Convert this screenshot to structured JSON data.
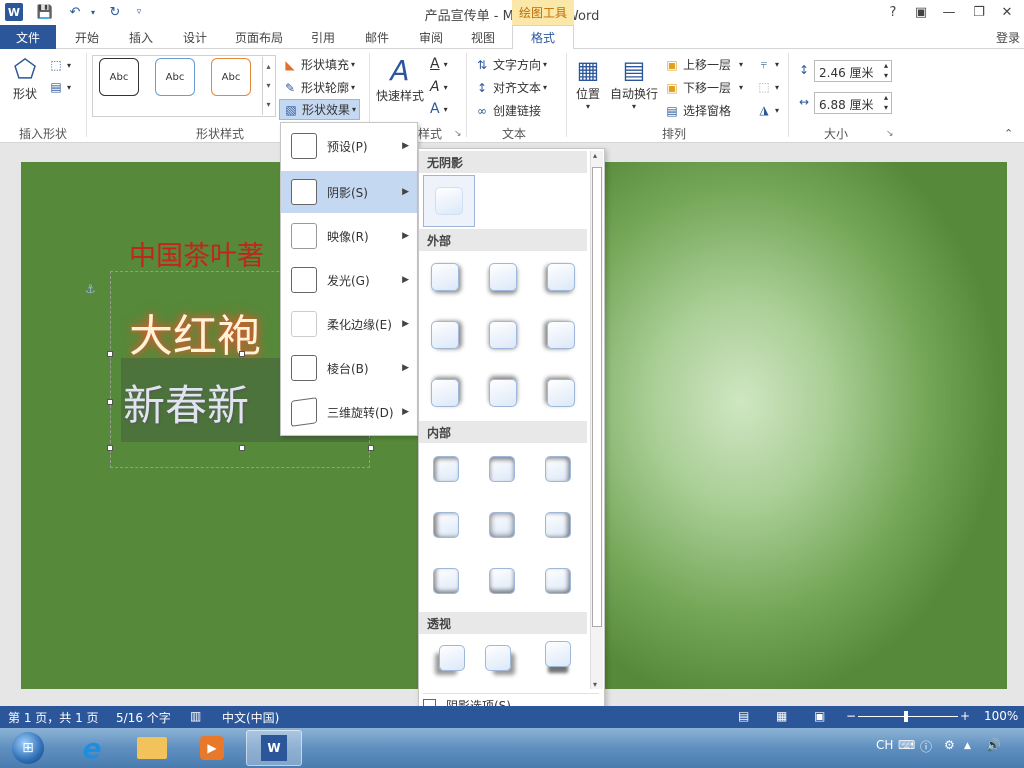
{
  "window": {
    "title": "产品宣传单 - Microsoft Word",
    "context_tab": "绘图工具",
    "logo": "W"
  },
  "tabs": {
    "file": "文件",
    "items": [
      "开始",
      "插入",
      "设计",
      "页面布局",
      "引用",
      "邮件",
      "审阅",
      "视图",
      "格式"
    ],
    "active": "格式",
    "login": "登录"
  },
  "ribbon": {
    "insert_shapes": {
      "shapes_label": "形状",
      "group": "插入形状"
    },
    "shape_styles": {
      "samples": [
        "Abc",
        "Abc",
        "Abc"
      ],
      "fill": "形状填充",
      "outline": "形状轮廓",
      "effects": "形状效果",
      "group": "形状样式"
    },
    "wordart": {
      "quick_styles": "快速样式",
      "group_partial": "样式"
    },
    "text": {
      "direction": "文字方向",
      "align": "对齐文本",
      "link": "创建链接",
      "group": "文本"
    },
    "arrange": {
      "position": "位置",
      "wrap": "自动换行",
      "bring_forward": "上移一层",
      "send_backward": "下移一层",
      "selection_pane": "选择窗格",
      "group": "排列"
    },
    "size": {
      "height": "2.46 厘米",
      "width": "6.88 厘米",
      "group": "大小"
    }
  },
  "document": {
    "line1": "中国茶叶著",
    "line2": "大红袍",
    "line3": "新春新"
  },
  "effects_menu": {
    "items": [
      {
        "label": "预设(P)"
      },
      {
        "label": "阴影(S)"
      },
      {
        "label": "映像(R)"
      },
      {
        "label": "发光(G)"
      },
      {
        "label": "柔化边缘(E)"
      },
      {
        "label": "棱台(B)"
      },
      {
        "label": "三维旋转(D)"
      }
    ],
    "highlighted_index": 1
  },
  "shadow_panel": {
    "no_shadow": "无阴影",
    "outer": "外部",
    "inner": "内部",
    "perspective": "透视",
    "options": "阴影选项(S)..."
  },
  "statusbar": {
    "page": "第 1 页，共 1 页",
    "words": "5/16 个字",
    "language": "中文(中国)",
    "zoom": "100%"
  },
  "taskbar": {
    "ime": "CH"
  },
  "colors": {
    "accent": "#2b579a",
    "context_tab_bg": "#fbe7a8",
    "context_tab_text": "#c06b00"
  }
}
